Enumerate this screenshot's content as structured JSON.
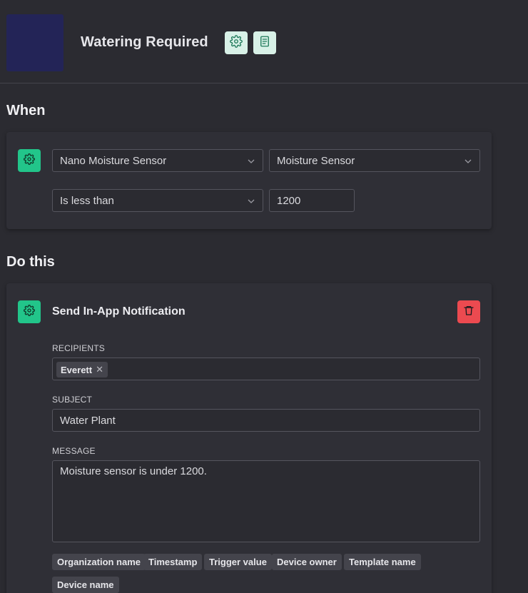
{
  "header": {
    "title": "Watering Required",
    "settings_icon": "gear-icon",
    "notes_icon": "document-icon"
  },
  "when": {
    "heading": "When",
    "device_select": "Nano Moisture Sensor",
    "datastream_select": "Moisture Sensor",
    "operator_select": "Is less than",
    "threshold_value": "1200"
  },
  "do_this": {
    "heading": "Do this",
    "action_title": "Send In-App Notification",
    "recipients_label": "RECIPIENTS",
    "recipients": [
      "Everett"
    ],
    "subject_label": "SUBJECT",
    "subject_value": "Water Plant",
    "message_label": "MESSAGE",
    "message_value": "Moisture sensor is under 1200.",
    "placeholders": [
      "Organization name",
      "Timestamp",
      "Trigger value",
      "Device owner",
      "Template name",
      "Device name"
    ]
  },
  "colors": {
    "background": "#2b2b31",
    "accent_green": "#22c58a",
    "danger_red": "#ec4a50",
    "logo_navy": "#232457"
  }
}
